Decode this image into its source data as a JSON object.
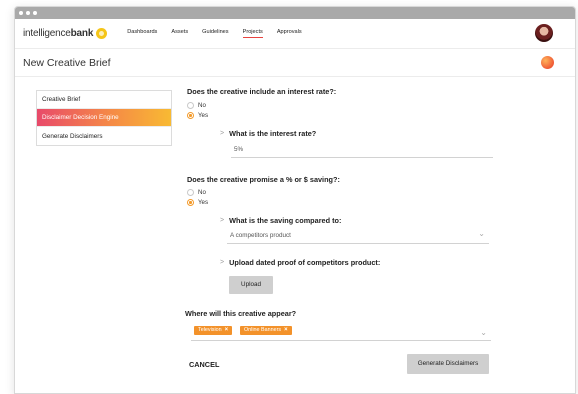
{
  "nav": {
    "logo_light": "intelligence",
    "logo_bold": "bank",
    "links": [
      "Dashboards",
      "Assets",
      "Guidelines",
      "Projects",
      "Approvals"
    ],
    "active_link": "Projects"
  },
  "page": {
    "title": "New Creative Brief"
  },
  "sidebar": {
    "items": [
      {
        "label": "Creative Brief",
        "active": false
      },
      {
        "label": "Disclaimer Decision Engine",
        "active": true
      },
      {
        "label": "Generate Disclaimers",
        "active": false
      }
    ]
  },
  "form": {
    "q1": {
      "question": "Does the creative include an interest rate?:",
      "options": [
        "No",
        "Yes"
      ],
      "selected": "Yes",
      "sub": {
        "label": "What is the interest rate?",
        "value": "5%"
      }
    },
    "q2": {
      "question": "Does the creative promise a % or $ saving?:",
      "options": [
        "No",
        "Yes"
      ],
      "selected": "Yes",
      "sub1": {
        "label": "What is the saving compared to:",
        "value": "A competitors product"
      },
      "sub2": {
        "label": "Upload dated proof of competitors product:",
        "button": "Upload"
      }
    },
    "q3": {
      "question": "Where will this creative appear?",
      "tags": [
        "Television",
        "Online Banners"
      ]
    },
    "cancel_label": "CANCEL",
    "generate_label": "Generate Disclaimers"
  },
  "colors": {
    "accent_orange": "#f3922a",
    "nav_active_underline": "#e8433f",
    "sidebar_gradient_start": "#e84a6a",
    "sidebar_gradient_end": "#f8ba33"
  }
}
